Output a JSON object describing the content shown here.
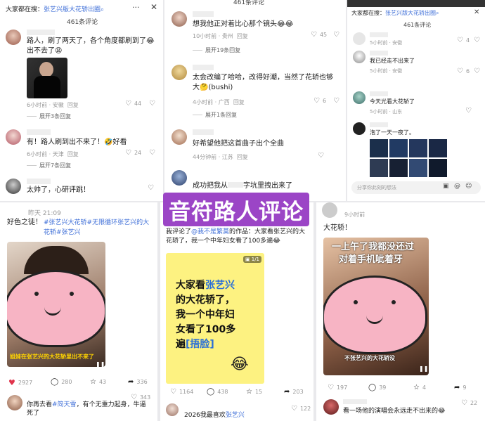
{
  "p1": {
    "header": "大家都在搜：",
    "header_link": "张艺兴版大花轿出圈",
    "count": "461条评论",
    "c1_text": "路人，刷了两天了，各个角度都刷到了",
    "c1_tail": "出不去了",
    "c1_meta": "6小时前 · 安徽",
    "c1_reply": "回复",
    "c1_likes": "44",
    "c1_expand": "展开3条回复",
    "c2_text": "有！路人刷到出不来了！",
    "c2_tail": "好看",
    "c2_meta": "6小时前 · 天津",
    "c2_reply": "回复",
    "c2_likes": "24",
    "c2_expand": "展开7条回复",
    "c3_text": "太帅了，心研评跳！"
  },
  "p2": {
    "count": "461条评论",
    "c1_text": "想我他正对着比心那个镜头",
    "c1_meta": "10小时前 · 贵州",
    "c1_reply": "回复",
    "c1_likes": "45",
    "c1_expand": "展开19条回复",
    "c2_text": "太会改编了哈哈，改得好潮，当然了花轿也够大",
    "c2_tail": "(bushi)",
    "c2_meta": "4小时前 · 广西",
    "c2_reply": "回复",
    "c2_likes": "6",
    "c2_expand": "展开1条回复",
    "c3_text": "好希望他把这首曲子出个全曲",
    "c3_meta": "44分钟前 · 江苏",
    "c3_reply": "回复",
    "c4_text": "成功把我从",
    "c4_tail": "字坑里拽出来了"
  },
  "p3": {
    "header": "大家都在搜：",
    "header_link": "张艺兴版大花轿出圈",
    "count": "461条评论",
    "c1_meta": "5小时前 · 安徽",
    "c1_likes": "4",
    "c2_text": "我已经走不出来了",
    "c2_meta": "5小时前 · 安徽",
    "c2_likes": "6",
    "c3_text": "今天光看大花轿了",
    "c3_meta": "5小时前 · 山东",
    "c4_text": "泡了一天一夜了。",
    "input_placeholder": "分享你此刻的想法"
  },
  "title_banner": "音符路人评论",
  "p4": {
    "time": "昨天 21:09",
    "text": "好色之徒！",
    "tags": "#张艺兴大花轿#无限循环张艺兴的大花轿#张艺兴",
    "caption": "姐妹在张艺兴的大花轿里出不来了",
    "likes": "2927",
    "comments": "280",
    "stars": "43",
    "shares": "336",
    "next_text": "你再去看",
    "next_link": "#简天雪",
    "next_tail": "，有个无重力起身，牛逼死了",
    "next_likes": "343"
  },
  "p5": {
    "text_prefix": "我评论了",
    "text_user": "@我不是繁莫",
    "text_rest": "的作品：大家看张艺兴的大花轿了，我一个中年妇女看了100多遍",
    "badge": "1/1",
    "card_l1a": "大家看",
    "card_l1b": "张艺兴",
    "card_l2": "的大花轿了，",
    "card_l3": "我一个中年妇",
    "card_l4": "女看了100多",
    "card_l5a": "遍",
    "card_l5b": "[捂脸]",
    "likes": "1164",
    "comments": "438",
    "stars": "15",
    "shares": "203",
    "next_text": "2026我最喜欢",
    "next_link": "张艺兴",
    "next_likes": "122"
  },
  "p6": {
    "meta": "9小时前",
    "text": "大花轿！",
    "overlay1": "一上午了我都没还过",
    "overlay2": "对着手机呲着牙",
    "caption": "不张艺兴的大花轿没",
    "likes": "197",
    "comments": "39",
    "stars": "4",
    "shares": "9",
    "next_text": "看一场他的演唱会永远走不出来的",
    "next_likes": "22"
  },
  "colors": {
    "accent": "#3f6fd8",
    "banner": "#9b45c6",
    "like_red": "#e0334b",
    "card_yellow": "#fdf281"
  }
}
